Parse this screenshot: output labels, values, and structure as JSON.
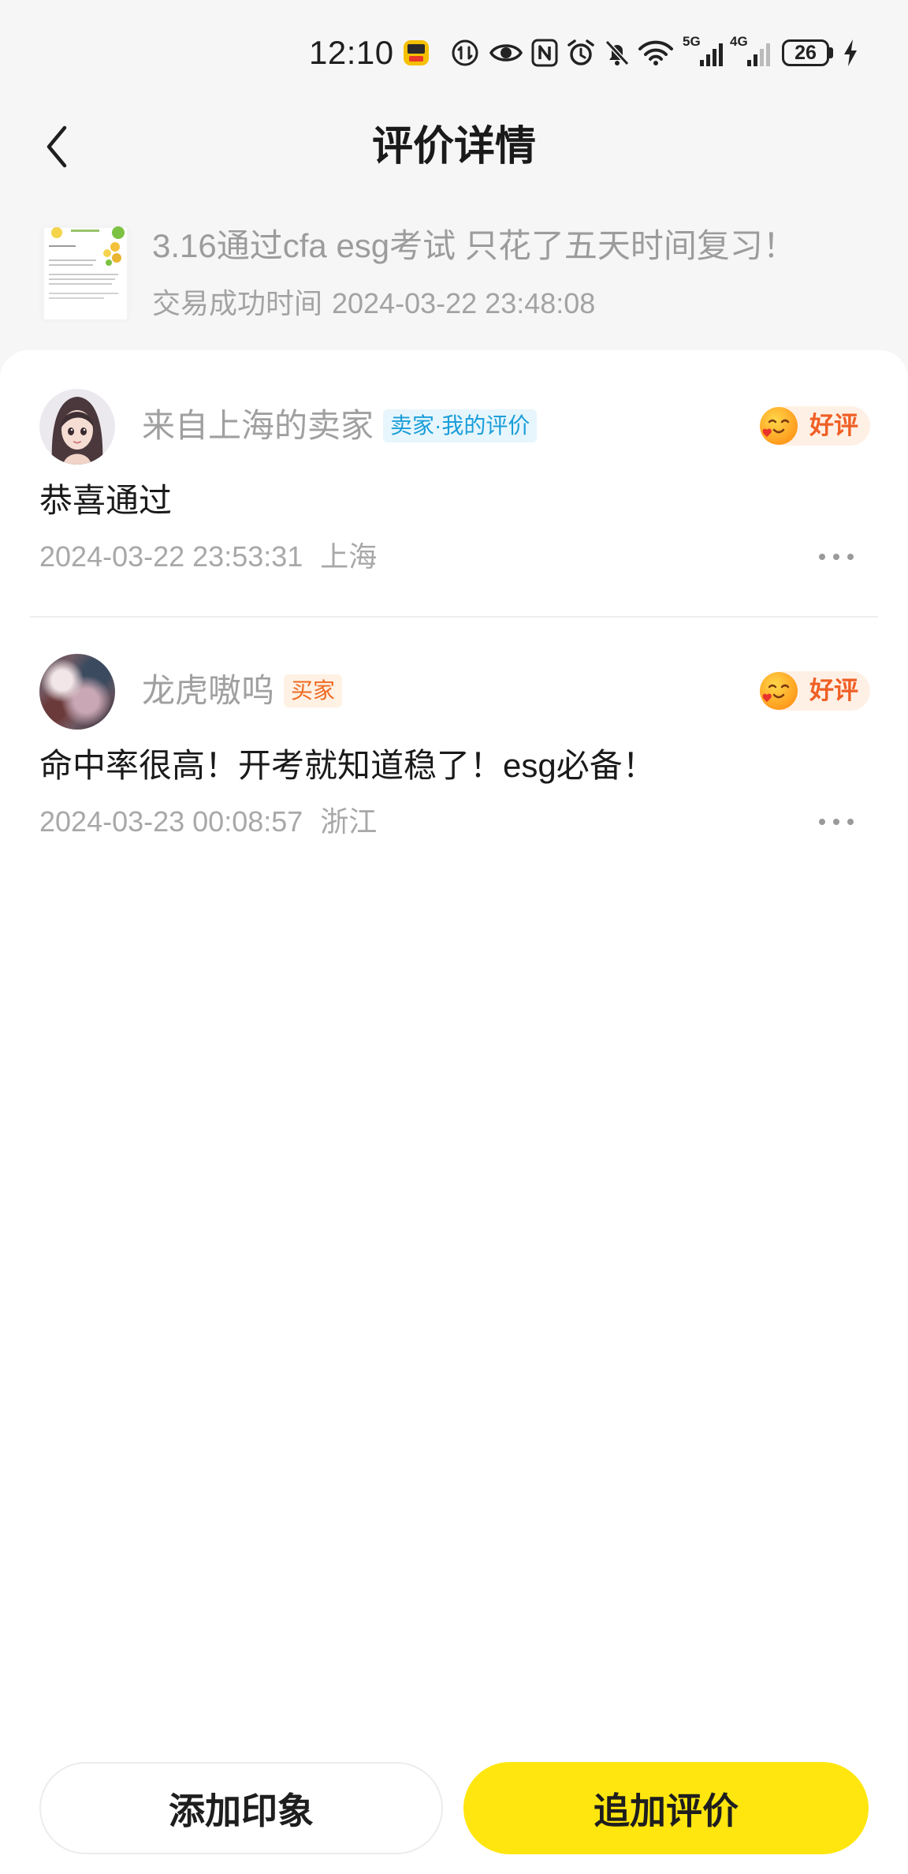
{
  "status_bar": {
    "time": "12:10",
    "signal_1_label": "5G",
    "signal_2_label": "4G",
    "battery_level": "26",
    "icons": [
      "app-notification-icon",
      "data-saver-icon",
      "eye-icon",
      "nfc-icon",
      "alarm-icon",
      "bell-off-icon",
      "wifi-icon",
      "signal-5g-icon",
      "signal-4g-icon",
      "battery-icon",
      "charging-icon"
    ]
  },
  "header": {
    "title": "评价详情",
    "back_icon": "chevron-left-icon"
  },
  "product": {
    "title": "3.16通过cfa esg考试 只花了五天时间复习！",
    "trade_time_label": "交易成功时间",
    "trade_time": "2024-03-22 23:48:08"
  },
  "reviews": [
    {
      "name": "来自上海的卖家",
      "role_tag": "卖家·我的评价",
      "rating": "好评",
      "rating_icon": "smiling-face-icon",
      "content": "恭喜通过",
      "date": "2024-03-22 23:53:31",
      "location": "上海",
      "more_icon": "more-dots-icon"
    },
    {
      "name": "龙虎嗷呜",
      "role_tag": "买家",
      "rating": "好评",
      "rating_icon": "smiling-face-icon",
      "content": "命中率很高！开考就知道稳了！esg必备！",
      "date": "2024-03-23 00:08:57",
      "location": "浙江",
      "more_icon": "more-dots-icon"
    }
  ],
  "actions": {
    "add_impression_label": "添加印象",
    "add_review_label": "追加评价"
  },
  "colors": {
    "accent_yellow": "#FFE60F",
    "page_background": "#F6F6F6",
    "secondary_text": "#A0A0A0",
    "seller_tag_text": "#1A9ED9",
    "seller_tag_bg": "#E7F6FC",
    "buyer_tag_text": "#EE6B22",
    "buyer_tag_bg": "#FFF1E4",
    "rating_text": "#EF5F25",
    "rating_bg": "#FFF0E5"
  }
}
